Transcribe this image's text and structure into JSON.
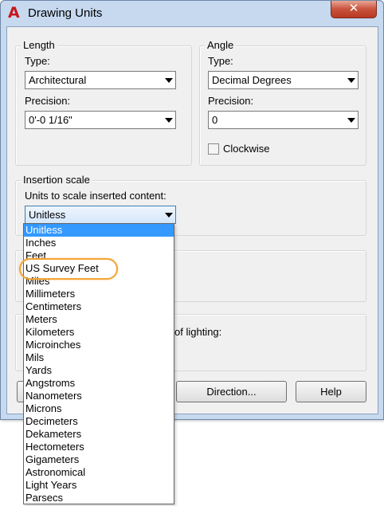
{
  "window": {
    "title": "Drawing Units",
    "close_glyph": "✕",
    "app_icon": "autocad-icon"
  },
  "length": {
    "group_title": "Length",
    "type_label": "Type:",
    "type_value": "Architectural",
    "precision_label": "Precision:",
    "precision_value": "0'-0 1/16\""
  },
  "angle": {
    "group_title": "Angle",
    "type_label": "Type:",
    "type_value": "Decimal Degrees",
    "precision_label": "Precision:",
    "precision_value": "0",
    "clockwise_label": "Clockwise",
    "clockwise_checked": false
  },
  "insertion": {
    "group_title": "Insertion scale",
    "units_label": "Units to scale inserted content:",
    "units_value": "Unitless",
    "options": [
      "Unitless",
      "Inches",
      "Feet",
      "US Survey Feet",
      "Miles",
      "Millimeters",
      "Centimeters",
      "Meters",
      "Kilometers",
      "Microinches",
      "Mils",
      "Yards",
      "Angstroms",
      "Nanometers",
      "Microns",
      "Decimeters",
      "Dekameters",
      "Hectometers",
      "Gigameters",
      "Astronomical",
      "Light Years",
      "Parsecs"
    ],
    "highlighted_option": "US Survey Feet"
  },
  "lighting": {
    "label_fragment": "of lighting:"
  },
  "buttons": {
    "direction": "Direction...",
    "help": "Help"
  },
  "colors": {
    "selection": "#3399ff",
    "highlight_ring": "#f3a436",
    "close_button": "#c9523c"
  }
}
